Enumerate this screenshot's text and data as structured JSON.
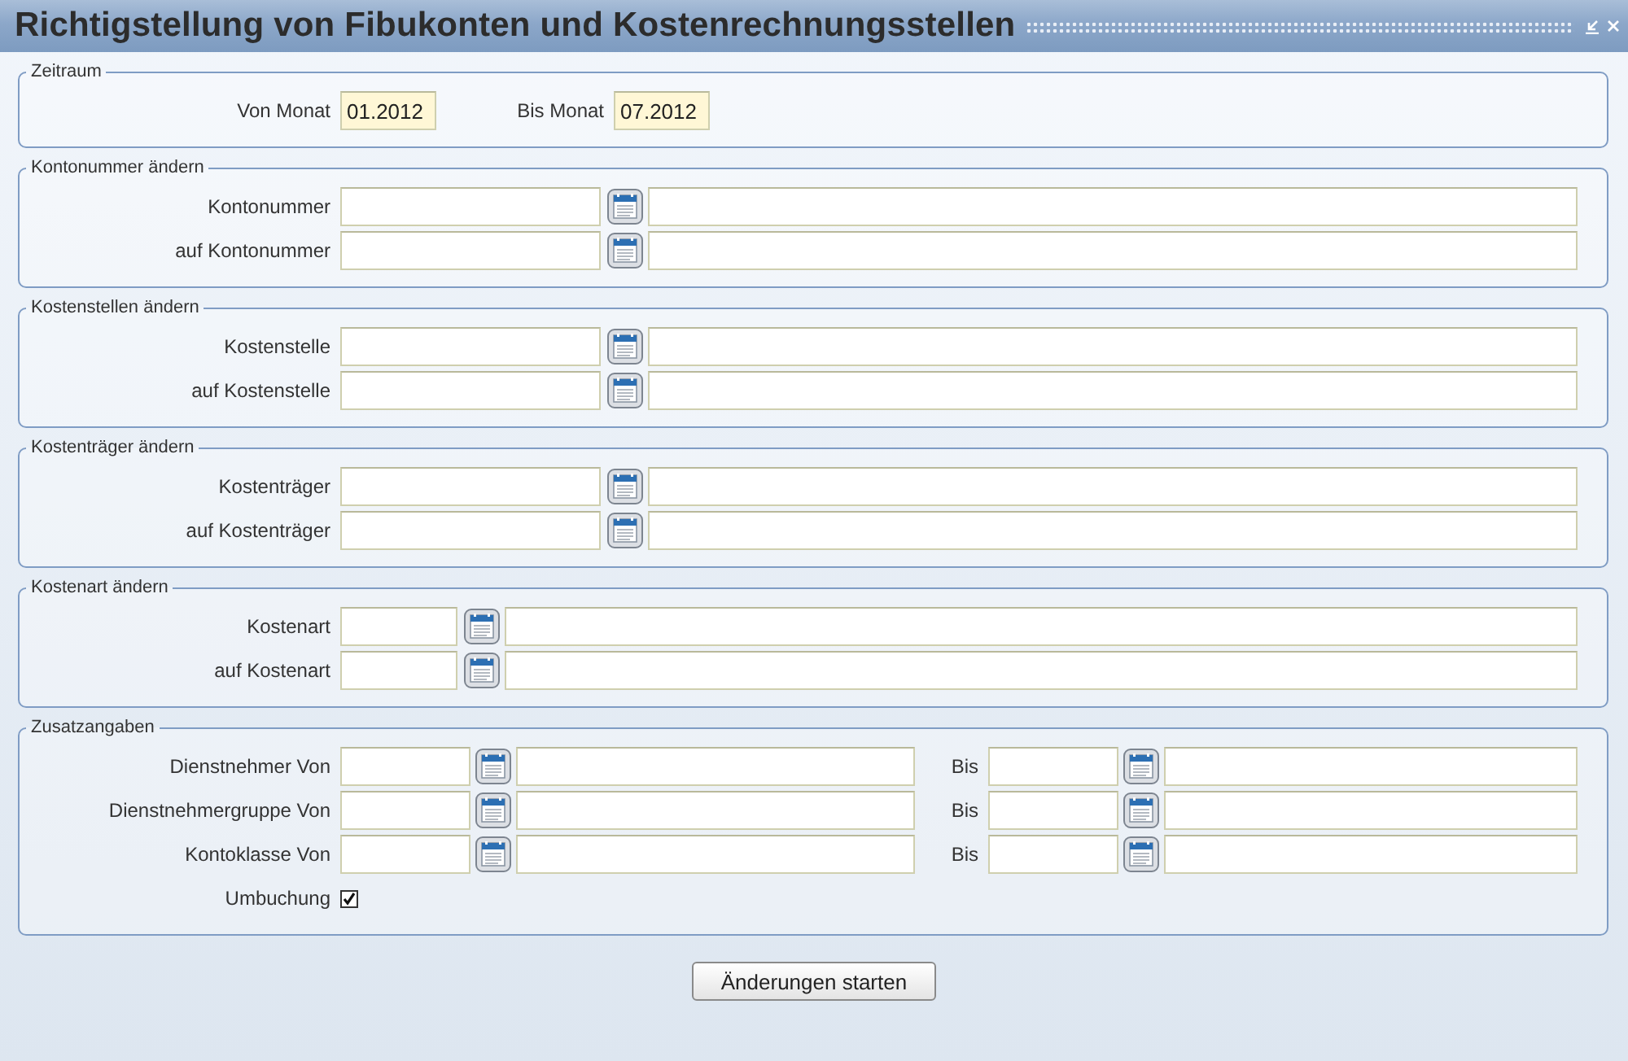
{
  "window": {
    "title": "Richtigstellung von Fibukonten und Kostenrechnungsstellen"
  },
  "period": {
    "legend": "Zeitraum",
    "fields": [
      {
        "label": "Von Monat",
        "value": "01.2012"
      },
      {
        "label": "Bis Monat",
        "value": "07.2012"
      }
    ]
  },
  "sections": [
    {
      "legend": "Kontonummer ändern",
      "kind": "long-code",
      "rows": [
        {
          "label": "Kontonummer"
        },
        {
          "label": "auf Kontonummer"
        }
      ]
    },
    {
      "legend": "Kostenstellen ändern",
      "kind": "long-code",
      "rows": [
        {
          "label": "Kostenstelle"
        },
        {
          "label": "auf Kostenstelle"
        }
      ]
    },
    {
      "legend": "Kostenträger ändern",
      "kind": "long-code",
      "rows": [
        {
          "label": "Kostenträger"
        },
        {
          "label": "auf Kostenträger"
        }
      ]
    },
    {
      "legend": "Kostenart ändern",
      "kind": "short-code",
      "rows": [
        {
          "label": "Kostenart"
        },
        {
          "label": "auf Kostenart"
        }
      ]
    }
  ],
  "extra": {
    "legend": "Zusatzangaben",
    "rows": [
      {
        "label": "Dienstnehmer Von",
        "to_label": "Bis"
      },
      {
        "label": "Dienstnehmergruppe Von",
        "to_label": "Bis"
      },
      {
        "label": "Kontoklasse Von",
        "to_label": "Bis"
      }
    ],
    "checkbox": {
      "label": "Umbuchung",
      "checked": true
    }
  },
  "button": {
    "label": "Änderungen starten"
  }
}
